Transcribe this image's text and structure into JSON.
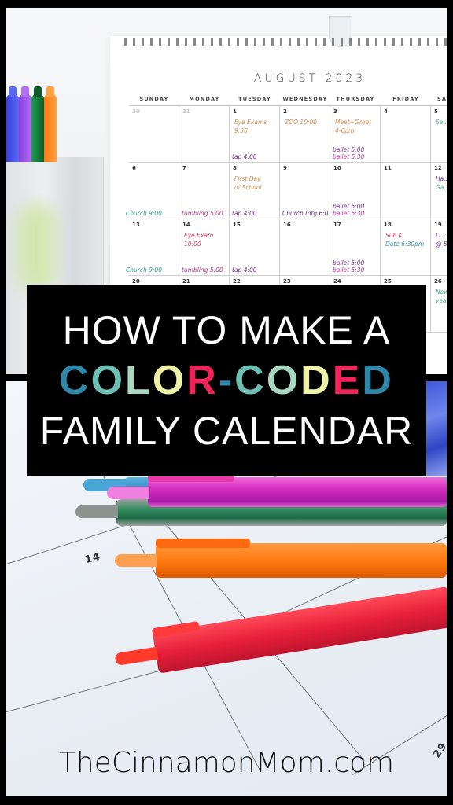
{
  "calendar": {
    "title": "AUGUST 2023",
    "weekdays": [
      "SUNDAY",
      "MONDAY",
      "TUESDAY",
      "WEDNESDAY",
      "THURSDAY",
      "FRIDAY",
      "SATURDAY"
    ],
    "weeks": [
      [
        {
          "day": "30",
          "faded": true,
          "notes": []
        },
        {
          "day": "31",
          "faded": true,
          "notes": []
        },
        {
          "day": "1",
          "notes": [
            {
              "text": "Eye Exams",
              "color": "#d98a4a"
            },
            {
              "text": "9:30",
              "color": "#d98a4a"
            },
            {
              "text": "tap 4:00",
              "color": "#6a2c8c"
            }
          ]
        },
        {
          "day": "2",
          "notes": [
            {
              "text": "ZOO 10:00",
              "color": "#d98a4a"
            }
          ]
        },
        {
          "day": "3",
          "notes": [
            {
              "text": "Meet+Greet",
              "color": "#d98a4a"
            },
            {
              "text": "4-6pm",
              "color": "#d98a4a"
            },
            {
              "text": "ballet 5:00",
              "color": "#6a2c8c"
            },
            {
              "text": "ballet 5:30",
              "color": "#b0338a"
            }
          ]
        },
        {
          "day": "4",
          "notes": []
        },
        {
          "day": "5",
          "notes": [
            {
              "text": "Sa...",
              "color": "#4aa898"
            }
          ]
        }
      ],
      [
        {
          "day": "6",
          "notes": [
            {
              "text": "Church 9:00",
              "color": "#2f9a86"
            }
          ]
        },
        {
          "day": "7",
          "notes": [
            {
              "text": "tumbling 5:00",
              "color": "#b0338a"
            }
          ]
        },
        {
          "day": "8",
          "notes": [
            {
              "text": "First Day",
              "color": "#d98a4a"
            },
            {
              "text": "of School",
              "color": "#d98a4a"
            },
            {
              "text": "tap 4:00",
              "color": "#6a2c8c"
            }
          ]
        },
        {
          "day": "9",
          "notes": [
            {
              "text": "Church mtg 6:0",
              "color": "#6a2c8c"
            }
          ]
        },
        {
          "day": "10",
          "notes": [
            {
              "text": "ballet 5:00",
              "color": "#6a2c8c"
            },
            {
              "text": "ballet 5:30",
              "color": "#b0338a"
            }
          ]
        },
        {
          "day": "11",
          "notes": []
        },
        {
          "day": "12",
          "notes": [
            {
              "text": "Ha...",
              "color": "#6a2c8c"
            },
            {
              "text": "Ga...",
              "color": "#4aa898"
            }
          ]
        }
      ],
      [
        {
          "day": "13",
          "notes": [
            {
              "text": "Church 9:00",
              "color": "#2f9a86"
            }
          ]
        },
        {
          "day": "14",
          "notes": [
            {
              "text": "Eye Exam",
              "color": "#d23a5a"
            },
            {
              "text": "10:00",
              "color": "#d23a5a"
            },
            {
              "text": "tumbling 5:00",
              "color": "#b0338a"
            }
          ]
        },
        {
          "day": "15",
          "notes": [
            {
              "text": "tap 4:00",
              "color": "#6a2c8c"
            }
          ]
        },
        {
          "day": "16",
          "notes": []
        },
        {
          "day": "17",
          "notes": [
            {
              "text": "ballet 5:00",
              "color": "#6a2c8c"
            },
            {
              "text": "ballet 5:30",
              "color": "#b0338a"
            }
          ]
        },
        {
          "day": "18",
          "notes": [
            {
              "text": "Sub K",
              "color": "#d23a5a"
            },
            {
              "text": "Date 6:30pm",
              "color": "#2f8fb0"
            }
          ]
        },
        {
          "day": "19",
          "notes": [
            {
              "text": "Li...",
              "color": "#6a2c8c"
            },
            {
              "text": "@ 5",
              "color": "#6a2c8c"
            }
          ]
        }
      ],
      [
        {
          "day": "20",
          "notes": []
        },
        {
          "day": "21",
          "notes": []
        },
        {
          "day": "22",
          "notes": []
        },
        {
          "day": "23",
          "notes": []
        },
        {
          "day": "24",
          "notes": []
        },
        {
          "day": "25",
          "notes": []
        },
        {
          "day": "26",
          "notes": [
            {
              "text": "New...",
              "color": "#4aa898"
            },
            {
              "text": "year...",
              "color": "#4aa898"
            }
          ]
        }
      ]
    ]
  },
  "banner": {
    "line1": "HOW TO MAKE A",
    "line2_letters": [
      {
        "char": "C",
        "color": "#2e86a8"
      },
      {
        "char": "O",
        "color": "#6fc0b4"
      },
      {
        "char": "L",
        "color": "#a9d8c0"
      },
      {
        "char": "O",
        "color": "#eef3a8"
      },
      {
        "char": "R",
        "color": "#f0245a"
      },
      {
        "char": "-",
        "color": "#2e86a8"
      },
      {
        "char": "C",
        "color": "#6fc0b4"
      },
      {
        "char": "O",
        "color": "#a9d8c0"
      },
      {
        "char": "D",
        "color": "#eef3a8"
      },
      {
        "char": "E",
        "color": "#f0245a"
      },
      {
        "char": "D",
        "color": "#2e86a8"
      }
    ],
    "line3": "FAMILY CALENDAR"
  },
  "bottom_photo": {
    "visible_dates": [
      "14",
      "29"
    ]
  },
  "footer": {
    "site": "TheCinnamonMom.com"
  },
  "colors": {
    "frame": "#000000",
    "banner_bg": "#000000",
    "banner_text": "#ffffff"
  }
}
